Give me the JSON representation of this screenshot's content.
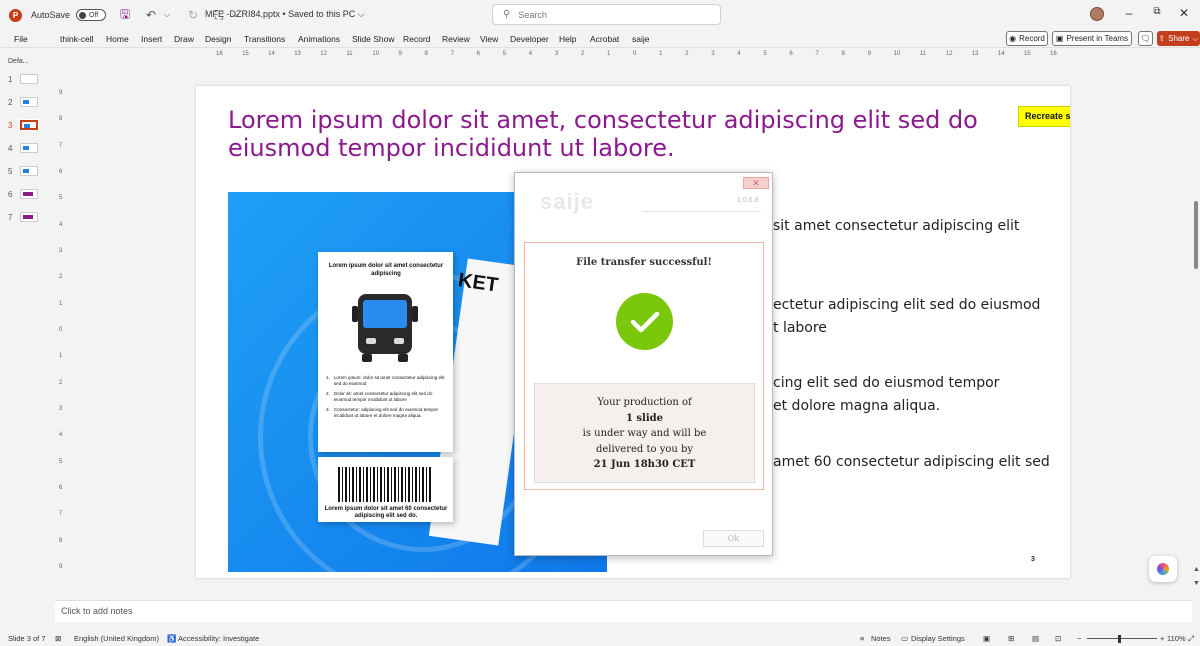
{
  "titlebar": {
    "autosave_label": "AutoSave",
    "autosave_state": "Off",
    "doc_title": "MFE -DZRI84.pptx • Saved to this PC ⌵",
    "search_placeholder": "Search"
  },
  "ribbon": {
    "tabs": [
      "File",
      "think-cell",
      "Home",
      "Insert",
      "Draw",
      "Design",
      "Transitions",
      "Animations",
      "Slide Show",
      "Record",
      "Review",
      "View",
      "Developer",
      "Help",
      "Acrobat",
      "saije"
    ],
    "record_label": "Record",
    "present_label": "Present in Teams",
    "share_label": "Share"
  },
  "thumbnails": {
    "section_label": "Defa...",
    "slides": [
      "1",
      "2",
      "3",
      "4",
      "5",
      "6",
      "7"
    ],
    "active_index": 2
  },
  "rulers": {
    "horizontal": [
      "16",
      "15",
      "14",
      "13",
      "12",
      "11",
      "10",
      "9",
      "8",
      "7",
      "6",
      "5",
      "4",
      "3",
      "2",
      "1",
      "0",
      "1",
      "2",
      "3",
      "4",
      "5",
      "6",
      "7",
      "8",
      "9",
      "10",
      "11",
      "12",
      "13",
      "14",
      "15",
      "16"
    ],
    "vertical": [
      "9",
      "8",
      "7",
      "6",
      "5",
      "4",
      "3",
      "2",
      "1",
      "0",
      "1",
      "2",
      "3",
      "4",
      "5",
      "6",
      "7",
      "8",
      "9"
    ]
  },
  "slide": {
    "title": "Lorem ipsum dolor sit amet, consectetur adipiscing elit sed do eiusmod tempor incididunt ut labore.",
    "sticky_note": "Recreate slide",
    "bullets": [
      "sit amet consectetur adipiscing elit",
      "ectetur adipiscing elit sed do eiusmod\nt labore",
      "cing elit sed do eiusmod tempor\net dolore magna aliqua.",
      "amet 60 consectetur adipiscing elit sed"
    ],
    "page_number": "3",
    "ticket": {
      "title": "Lorem ipsum dolor sit amet consectetur adipiscing",
      "back_text": "KET",
      "items": [
        {
          "num": "1.",
          "text": "Lorem ipsum: dolor sit amet consectetur adipiscing elit sed do eiusmod"
        },
        {
          "num": "2.",
          "text": "Dolor sit: amet consectetur adipiscing elit sed do eiusmod tempor incididunt ut labore"
        },
        {
          "num": "3.",
          "text": "Consectetur: adipiscing elit sed do eiusmod tempor incididunt ut labore et dolore magna aliqua."
        }
      ],
      "stub_text": "Lorem ipsum dolor sit amet 60 consectetur adipiscing elit sed do."
    }
  },
  "dialog": {
    "logo": "saije",
    "version": "1.0.6.8",
    "close_symbol": "✕",
    "heading": "File transfer successful!",
    "line1": "Your production of",
    "line2": "1 slide",
    "line3": "is under way and will be",
    "line4": "delivered to you by",
    "line5": "21 Jun 18h30 CET",
    "ok_label": "Ok"
  },
  "notes": {
    "placeholder": "Click to add notes"
  },
  "statusbar": {
    "slide_info": "Slide 3 of 7",
    "language": "English (United Kingdom)",
    "accessibility": "Accessibility: Investigate",
    "notes_label": "Notes",
    "display_settings": "Display Settings",
    "zoom": "110%"
  },
  "colors": {
    "accent": "#c43e1c",
    "title_purple": "#8b1a8c",
    "sticky_yellow": "#ffff00",
    "check_green": "#7ac70c"
  }
}
